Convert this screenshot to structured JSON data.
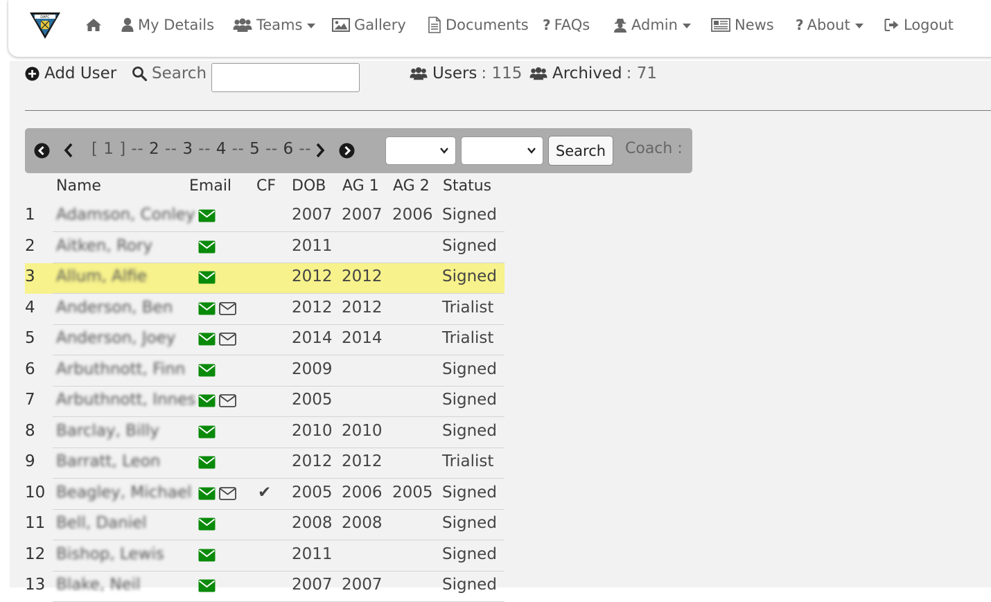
{
  "nav": {
    "items": [
      {
        "label": "",
        "icon": "home-icon"
      },
      {
        "label": "My Details",
        "icon": "user-icon"
      },
      {
        "label": "Teams",
        "icon": "users-icon",
        "dropdown": true
      },
      {
        "label": "Gallery",
        "icon": "image-icon"
      },
      {
        "label": "Documents",
        "icon": "file-icon"
      },
      {
        "label": "FAQs",
        "icon": "question-icon"
      },
      {
        "label": "Admin",
        "icon": "user-secret-icon",
        "dropdown": true
      },
      {
        "label": "News",
        "icon": "newspaper-icon"
      },
      {
        "label": "About",
        "icon": "question-icon",
        "dropdown": true
      },
      {
        "label": "Logout",
        "icon": "sign-out-icon"
      }
    ]
  },
  "toolbar": {
    "add_user": "Add User",
    "search_label": "Search :",
    "search_value": ""
  },
  "counts": {
    "users_label": "Users",
    "users_value": ": 115",
    "archived_label": "Archived",
    "archived_value": ": 71"
  },
  "pager": {
    "current": "[ 1 ]",
    "pages": [
      "2",
      "3",
      "4",
      "5",
      "6"
    ],
    "separator": "--",
    "select1": "",
    "select2": "",
    "search_button": "Search",
    "coach_label": "Coach :"
  },
  "table": {
    "headers": {
      "name": "Name",
      "email": "Email",
      "cf": "CF",
      "dob": "DOB",
      "ag1": "AG 1",
      "ag2": "AG 2",
      "status": "Status"
    },
    "rows": [
      {
        "idx": "1",
        "name": "Adamson, Conley",
        "email_outline": false,
        "cf": "",
        "dob": "2007",
        "ag1": "2007",
        "ag2": "2006",
        "status": "Signed",
        "highlight": false
      },
      {
        "idx": "2",
        "name": "Aitken, Rory",
        "email_outline": false,
        "cf": "",
        "dob": "2011",
        "ag1": "",
        "ag2": "",
        "status": "Signed",
        "highlight": false
      },
      {
        "idx": "3",
        "name": "Allum, Alfie",
        "email_outline": false,
        "cf": "",
        "dob": "2012",
        "ag1": "2012",
        "ag2": "",
        "status": "Signed",
        "highlight": true
      },
      {
        "idx": "4",
        "name": "Anderson, Ben",
        "email_outline": true,
        "cf": "",
        "dob": "2012",
        "ag1": "2012",
        "ag2": "",
        "status": "Trialist",
        "highlight": false
      },
      {
        "idx": "5",
        "name": "Anderson, Joey",
        "email_outline": true,
        "cf": "",
        "dob": "2014",
        "ag1": "2014",
        "ag2": "",
        "status": "Trialist",
        "highlight": false
      },
      {
        "idx": "6",
        "name": "Arbuthnott, Finn",
        "email_outline": false,
        "cf": "",
        "dob": "2009",
        "ag1": "",
        "ag2": "",
        "status": "Signed",
        "highlight": false
      },
      {
        "idx": "7",
        "name": "Arbuthnott, Innes",
        "email_outline": true,
        "cf": "",
        "dob": "2005",
        "ag1": "",
        "ag2": "",
        "status": "Signed",
        "highlight": false
      },
      {
        "idx": "8",
        "name": "Barclay, Billy",
        "email_outline": false,
        "cf": "",
        "dob": "2010",
        "ag1": "2010",
        "ag2": "",
        "status": "Signed",
        "highlight": false
      },
      {
        "idx": "9",
        "name": "Barratt, Leon",
        "email_outline": false,
        "cf": "",
        "dob": "2012",
        "ag1": "2012",
        "ag2": "",
        "status": "Trialist",
        "highlight": false
      },
      {
        "idx": "10",
        "name": "Beagley, Michael",
        "email_outline": true,
        "cf": "✔",
        "dob": "2005",
        "ag1": "2006",
        "ag2": "2005",
        "status": "Signed",
        "highlight": false
      },
      {
        "idx": "11",
        "name": "Bell, Daniel",
        "email_outline": false,
        "cf": "",
        "dob": "2008",
        "ag1": "2008",
        "ag2": "",
        "status": "Signed",
        "highlight": false
      },
      {
        "idx": "12",
        "name": "Bishop, Lewis",
        "email_outline": false,
        "cf": "",
        "dob": "2011",
        "ag1": "",
        "ag2": "",
        "status": "Signed",
        "highlight": false
      },
      {
        "idx": "13",
        "name": "Blake, Neil",
        "email_outline": false,
        "cf": "",
        "dob": "2007",
        "ag1": "2007",
        "ag2": "",
        "status": "Signed",
        "highlight": false
      }
    ]
  },
  "colors": {
    "email_green": "#0a8a0a",
    "highlight": "#f7f28b",
    "pager_bg": "#acacac",
    "content_bg": "#f2f2f2"
  }
}
